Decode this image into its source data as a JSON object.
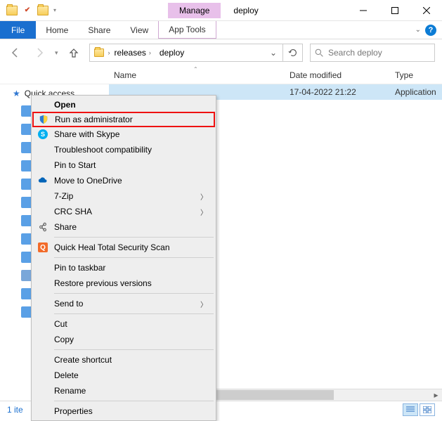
{
  "window": {
    "manage_label": "Manage",
    "title": "deploy"
  },
  "ribbon": {
    "file": "File",
    "tabs": [
      "Home",
      "Share",
      "View"
    ],
    "context_tab": "App Tools"
  },
  "breadcrumb": {
    "segments": [
      "releases",
      "deploy"
    ]
  },
  "search": {
    "placeholder": "Search deploy"
  },
  "columns": {
    "name": "Name",
    "date": "Date modified",
    "type": "Type"
  },
  "nav": {
    "quick_access": "Quick access"
  },
  "file_row": {
    "date": "17-04-2022 21:22",
    "type": "Application"
  },
  "context_menu": {
    "open": "Open",
    "run_admin": "Run as administrator",
    "skype": "Share with Skype",
    "troubleshoot": "Troubleshoot compatibility",
    "pin_start": "Pin to Start",
    "onedrive": "Move to OneDrive",
    "sevenzip": "7-Zip",
    "crc": "CRC SHA",
    "share": "Share",
    "quickheal": "Quick Heal Total Security Scan",
    "pin_taskbar": "Pin to taskbar",
    "restore": "Restore previous versions",
    "sendto": "Send to",
    "cut": "Cut",
    "copy": "Copy",
    "shortcut": "Create shortcut",
    "delete": "Delete",
    "rename": "Rename",
    "properties": "Properties"
  },
  "status": {
    "text": "1 ite"
  }
}
